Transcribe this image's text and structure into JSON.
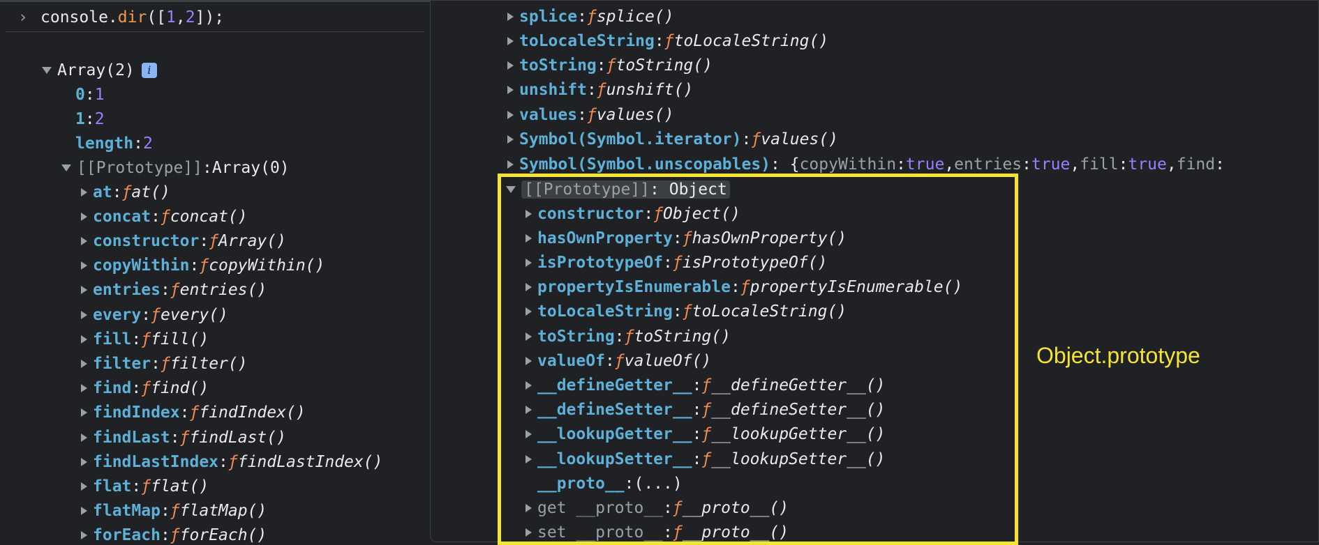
{
  "console": {
    "prompt_glyph": "›",
    "input_text_1": "console.",
    "input_method": "dir",
    "input_text_2": "([",
    "input_n1": "1",
    "input_comma": ", ",
    "input_n2": "2",
    "input_text_3": "]);"
  },
  "left": {
    "array_label": "Array(2)",
    "info_glyph": "i",
    "entries": [
      {
        "key": "0",
        "value": "1"
      },
      {
        "key": "1",
        "value": "2"
      },
      {
        "key": "length",
        "value": "2"
      }
    ],
    "prototype_key": "[[Prototype]]",
    "prototype_value": "Array(0)",
    "methods": [
      {
        "key": "at",
        "fn": "at()"
      },
      {
        "key": "concat",
        "fn": "concat()"
      },
      {
        "key": "constructor",
        "fn": "Array()"
      },
      {
        "key": "copyWithin",
        "fn": "copyWithin()"
      },
      {
        "key": "entries",
        "fn": "entries()"
      },
      {
        "key": "every",
        "fn": "every()"
      },
      {
        "key": "fill",
        "fn": "fill()"
      },
      {
        "key": "filter",
        "fn": "filter()"
      },
      {
        "key": "find",
        "fn": "find()"
      },
      {
        "key": "findIndex",
        "fn": "findIndex()"
      },
      {
        "key": "findLast",
        "fn": "findLast()"
      },
      {
        "key": "findLastIndex",
        "fn": "findLastIndex()"
      },
      {
        "key": "flat",
        "fn": "flat()"
      },
      {
        "key": "flatMap",
        "fn": "flatMap()"
      },
      {
        "key": "forEach",
        "fn": "forEach()"
      }
    ]
  },
  "right": {
    "top_methods": [
      {
        "key": "splice",
        "fn": "splice()"
      },
      {
        "key": "toLocaleString",
        "fn": "toLocaleString()"
      },
      {
        "key": "toString",
        "fn": "toString()"
      },
      {
        "key": "unshift",
        "fn": "unshift()"
      },
      {
        "key": "values",
        "fn": "values()"
      },
      {
        "key": "Symbol(Symbol.iterator)",
        "fn": "values()"
      }
    ],
    "unscopables_key": "Symbol(Symbol.unscopables)",
    "unscopables_preview": [
      {
        "k": "copyWithin",
        "v": "true"
      },
      {
        "k": "entries",
        "v": "true"
      },
      {
        "k": "fill",
        "v": "true"
      },
      {
        "k": "find",
        "v": ""
      }
    ],
    "object_proto_key": "[[Prototype]]",
    "object_proto_value": "Object",
    "object_methods": [
      {
        "key": "constructor",
        "fn": "Object()"
      },
      {
        "key": "hasOwnProperty",
        "fn": "hasOwnProperty()"
      },
      {
        "key": "isPrototypeOf",
        "fn": "isPrototypeOf()"
      },
      {
        "key": "propertyIsEnumerable",
        "fn": "propertyIsEnumerable()"
      },
      {
        "key": "toLocaleString",
        "fn": "toLocaleString()"
      },
      {
        "key": "toString",
        "fn": "toString()"
      },
      {
        "key": "valueOf",
        "fn": "valueOf()"
      },
      {
        "key": "__defineGetter__",
        "fn": "__defineGetter__()"
      },
      {
        "key": "__defineSetter__",
        "fn": "__defineSetter__()"
      },
      {
        "key": "__lookupGetter__",
        "fn": "__lookupGetter__()"
      },
      {
        "key": "__lookupSetter__",
        "fn": "__lookupSetter__()"
      }
    ],
    "proto_getter_key": "__proto__",
    "proto_getter_value": "(...)",
    "accessors": [
      {
        "key": "get __proto__",
        "fn": "__proto__()"
      },
      {
        "key": "set __proto__",
        "fn": "__proto__()"
      }
    ]
  },
  "annotation": "Object.prototype",
  "f_glyph": "ƒ",
  "colors": {
    "highlight_box": "#f4e430",
    "background": "#202124"
  }
}
